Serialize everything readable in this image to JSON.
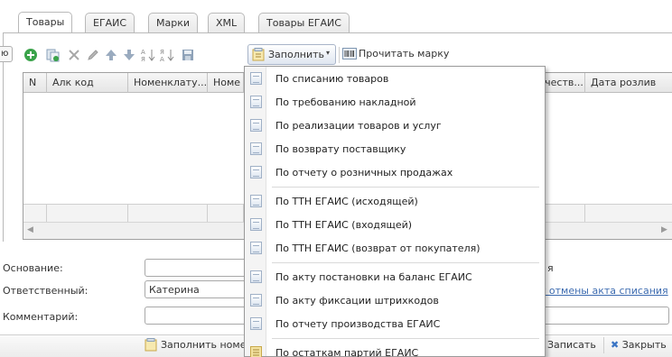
{
  "tabs": [
    {
      "label": "Товары",
      "active": true
    },
    {
      "label": "ЕГАИС",
      "active": false
    },
    {
      "label": "Марки",
      "active": false
    },
    {
      "label": "XML",
      "active": false
    },
    {
      "label": "Товары ЕГАИС",
      "active": false
    }
  ],
  "left_cut_label": "ю",
  "toolbar": {
    "fill_label": "Заполнить",
    "read_mark_label": "Прочитать марку"
  },
  "grid": {
    "columns": [
      "N",
      "Алк код",
      "Номенклату...",
      "Номе",
      "ичеств...",
      "Дата розлив"
    ]
  },
  "form": {
    "basis_label": "Основание:",
    "basis_value": "",
    "responsible_label": "Ответственный:",
    "responsible_value": "Катерина",
    "comment_label": "Комментарий:",
    "comment_value": "",
    "right_cut_text": "я",
    "cancel_act_link": "т отмены акта списания"
  },
  "bottom": {
    "fill_nomenclature_label": "Заполнить номе",
    "save_label": "Записать",
    "close_label": "Закрыть"
  },
  "menu": {
    "items": [
      "По списанию товаров",
      "По требованию накладной",
      "По реализации товаров и услуг",
      "По возврату поставщику",
      "По отчету о розничных продажах",
      "По ТТН ЕГАИС (исходящей)",
      "По ТТН ЕГАИС (входящей)",
      "По ТТН ЕГАИС (возврат от покупателя)",
      "По акту постановки на баланс ЕГАИС",
      "По акту фиксации штрихкодов",
      "По отчету производства ЕГАИС",
      "По остаткам партий ЕГАИС"
    ]
  },
  "colors": {
    "accent_green": "#3aa34a",
    "link_blue": "#3c6bb0",
    "close_x": "#3a74c4"
  }
}
